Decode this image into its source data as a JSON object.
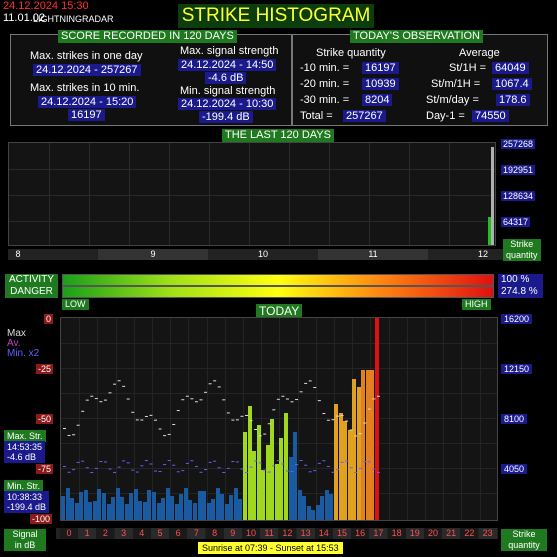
{
  "header": {
    "date": "24.12.2024 15:30",
    "version": "11.01.02",
    "brand": "LIGHTNINGRADAR",
    "title": "STRIKE HISTOGRAM"
  },
  "score": {
    "heading": "SCORE RECORDED IN 120 DAYS",
    "max_day_label": "Max. strikes in one day",
    "max_day_value": "24.12.2024 - 257267",
    "max_10min_label": "Max. strikes in 10 min.",
    "max_10min_date": "24.12.2024 - 15:20",
    "max_10min_value": "16197",
    "max_signal_label": "Max. signal strength",
    "max_signal_date": "24.12.2024 - 14:50",
    "max_signal_value": "-4.6 dB",
    "min_signal_label": "Min. signal strength",
    "min_signal_date": "24.12.2024 - 10:30",
    "min_signal_value": "-199.4 dB"
  },
  "today": {
    "heading": "TODAY'S OBSERVATION",
    "quantity_label": "Strike quantity",
    "average_label": "Average",
    "rows": [
      {
        "label": "-10 min. =",
        "value": "16197",
        "avg_label": "St/1H =",
        "avg_value": "64049"
      },
      {
        "label": "-20 min. =",
        "value": "10939",
        "avg_label": "St/m/1H =",
        "avg_value": "1067.4"
      },
      {
        "label": "-30 min. =",
        "value": "8204",
        "avg_label": "St/m/day =",
        "avg_value": "178.6"
      },
      {
        "label": "Total =",
        "value": "257267",
        "avg_label": "Day-1 =",
        "avg_value": "74550"
      }
    ]
  },
  "last120": {
    "heading": "THE LAST 120 DAYS",
    "y_ticks": [
      "257268",
      "192951",
      "128634",
      "64317"
    ],
    "month_labels": [
      "8",
      "9",
      "10",
      "11",
      "12"
    ],
    "axis_label_1": "Strike",
    "axis_label_2": "quantity",
    "last_values": [
      0.0,
      0.0,
      0.0,
      0.29,
      1.0
    ]
  },
  "activity": {
    "activity_label": "ACTIVITY",
    "danger_label": "DANGER",
    "activity_value": "100 %",
    "danger_value": "274.8 %",
    "low": "LOW",
    "high": "HIGH",
    "activity_level": 1.0,
    "danger_level": 1.0
  },
  "todaychart": {
    "heading": "TODAY",
    "legend_max": "Max",
    "legend_av": "Av.",
    "legend_min": "Min. x2",
    "left_ticks": [
      "0",
      "-25",
      "-50",
      "-75",
      "-100"
    ],
    "right_ticks": [
      "16200",
      "12150",
      "8100",
      "4050"
    ],
    "max_str_label": "Max. Str.",
    "max_str_time": "14:53:35",
    "max_str_value": "-4.6 dB",
    "min_str_label": "Min. Str.",
    "min_str_time": "10:38:33",
    "min_str_value": "-199.4 dB",
    "hours": [
      "0",
      "1",
      "2",
      "3",
      "4",
      "5",
      "6",
      "7",
      "8",
      "9",
      "10",
      "11",
      "12",
      "13",
      "14",
      "15",
      "16",
      "17",
      "18",
      "19",
      "20",
      "21",
      "22",
      "23"
    ],
    "signal_label_1": "Signal",
    "signal_label_2": "in dB",
    "strike_label_1": "Strike",
    "strike_label_2": "quantity",
    "sun": "Sunrise at 07:39  -  Sunset at 15:53"
  },
  "colors": {
    "green_label": "#1f7a1f",
    "navy": "#1a1a8c",
    "red_marker": "#e01010"
  }
}
